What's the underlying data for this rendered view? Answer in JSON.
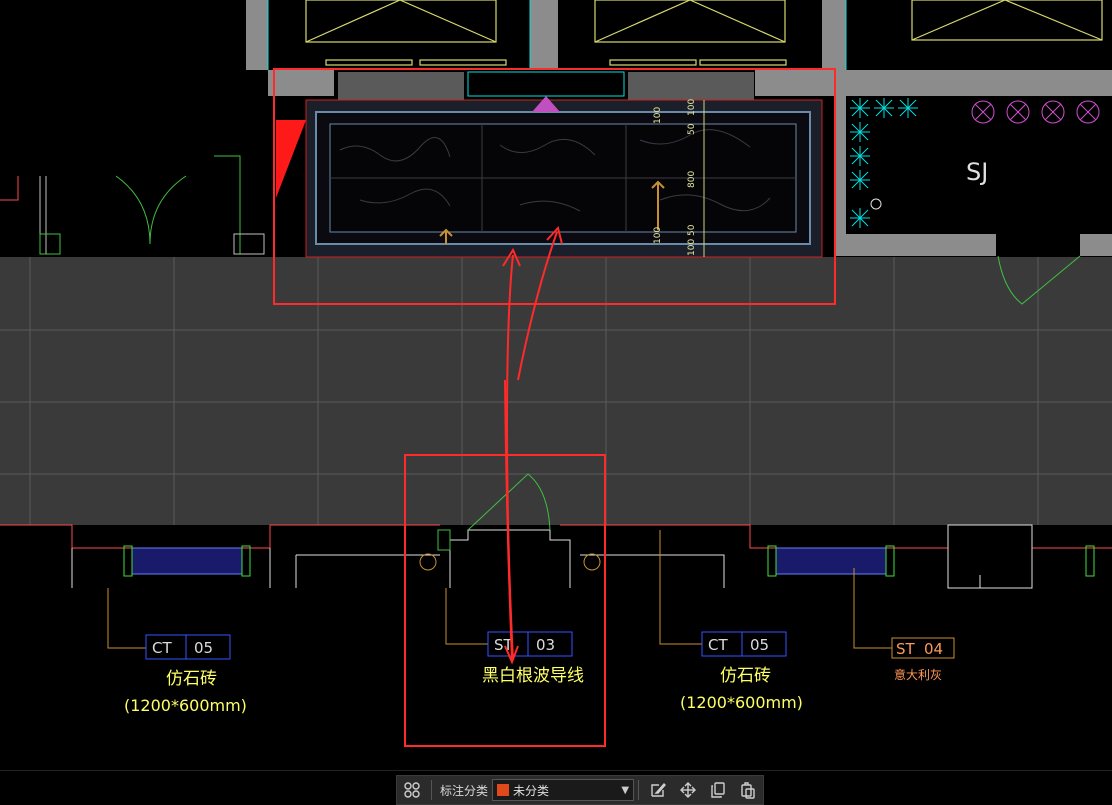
{
  "colors": {
    "background": "#000000",
    "corridor": "#3a3a3a",
    "wall": "#8c8c8c",
    "annotation_box": "#ff2a2a",
    "tag_box": "#3355ff",
    "tag_text": "#dcdcdc",
    "label_yellow": "#ffff66",
    "label_orange": "#ff9955",
    "dim_text": "#e8e8a0",
    "cyan": "#00e0e0",
    "category_swatch": "#e04a1a"
  },
  "drawing": {
    "room_label": "SJ",
    "dimensions": [
      "100",
      "50",
      "800",
      "50",
      "100"
    ],
    "tags": [
      {
        "code": "CT",
        "num": "05",
        "name": "仿石砖",
        "spec": "(1200*600mm)"
      },
      {
        "code": "ST",
        "num": "03",
        "name": "黑白根波导线",
        "spec": ""
      },
      {
        "code": "CT",
        "num": "05",
        "name": "仿石砖",
        "spec": "(1200*600mm)"
      },
      {
        "code": "ST",
        "num": "04",
        "name": "意大利灰",
        "spec": ""
      }
    ]
  },
  "toolbar": {
    "category_label": "标注分类",
    "category_value": "未分类",
    "icons": [
      "grid-icon",
      "edit-icon",
      "move-icon",
      "copy-icon",
      "paste-icon"
    ]
  }
}
